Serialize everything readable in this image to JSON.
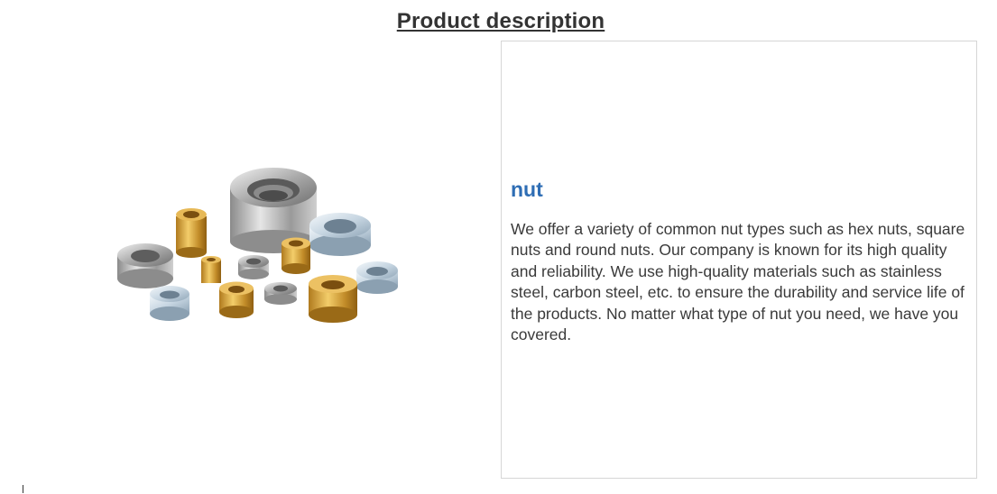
{
  "header": {
    "title": "Product description"
  },
  "product": {
    "image_alt": "assortment of brass and steel nuts",
    "name": "nut",
    "description": "We offer a variety of common nut types such as hex nuts, square nuts and round nuts. Our company is known for its high quality and reliability. We use high-quality materials such as stainless steel, carbon steel, etc. to ensure the durability and service life of the products. No matter what type of nut you need, we have you covered."
  },
  "colors": {
    "title_text": "#333333",
    "product_name": "#2e6db4",
    "body_text": "#3a3a3a",
    "panel_border": "#d6d6d6"
  }
}
